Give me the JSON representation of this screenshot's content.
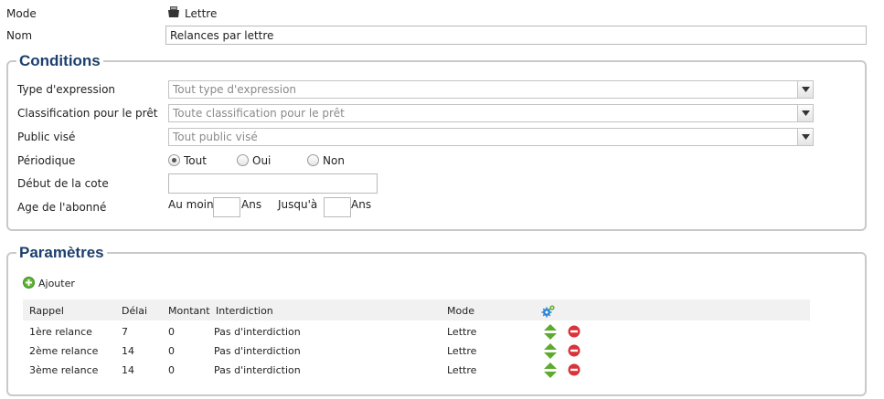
{
  "mode": {
    "label": "Mode",
    "value": "Lettre",
    "icon": "letter-icon"
  },
  "nom": {
    "label": "Nom",
    "value": "Relances par lettre"
  },
  "conditions": {
    "legend": "Conditions",
    "type_expression": {
      "label": "Type d'expression",
      "placeholder": "Tout type d'expression"
    },
    "classification": {
      "label": "Classification pour le prêt",
      "placeholder": "Toute classification pour le prêt"
    },
    "public": {
      "label": "Public visé",
      "placeholder": "Tout public visé"
    },
    "periodique": {
      "label": "Périodique",
      "options": [
        "Tout",
        "Oui",
        "Non"
      ],
      "selected": "Tout"
    },
    "debut_cote": {
      "label": "Début de la cote",
      "value": ""
    },
    "age": {
      "label": "Age de l'abonné",
      "min_label": "Au moins",
      "min_unit": "Ans",
      "max_label": "Jusqu'à",
      "max_unit": "Ans",
      "min_value": "",
      "max_value": ""
    }
  },
  "parametres": {
    "legend": "Paramètres",
    "add_label": "Ajouter",
    "columns": [
      "Rappel",
      "Délai",
      "Montant",
      "Interdiction",
      "Mode"
    ],
    "rows": [
      {
        "rappel": "1ère relance",
        "delai": "7",
        "montant": "0",
        "interdiction": "Pas d'interdiction",
        "mode": "Lettre"
      },
      {
        "rappel": "2ème relance",
        "delai": "14",
        "montant": "0",
        "interdiction": "Pas d'interdiction",
        "mode": "Lettre"
      },
      {
        "rappel": "3ème relance",
        "delai": "14",
        "montant": "0",
        "interdiction": "Pas d'interdiction",
        "mode": "Lettre"
      }
    ]
  },
  "colors": {
    "legend": "#1d3f6d",
    "up_down": "#5cab2f",
    "delete": "#d9343a",
    "settings": "#2c87d6"
  }
}
